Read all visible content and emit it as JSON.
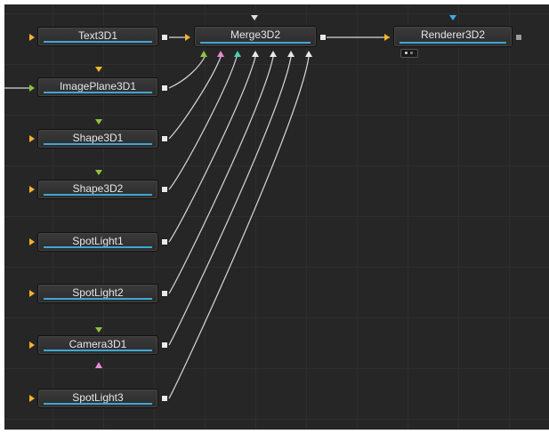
{
  "nodes": {
    "text3d1": "Text3D1",
    "merge3d2": "Merge3D2",
    "renderer3d2": "Renderer3D2",
    "imageplane3d1": "ImagePlane3D1",
    "shape3d1": "Shape3D1",
    "shape3d2": "Shape3D2",
    "spotlight1": "SpotLight1",
    "spotlight2": "SpotLight2",
    "camera3d1": "Camera3D1",
    "spotlight3": "SpotLight3"
  },
  "colors": {
    "background": "#262626",
    "node_bar": "#3ea6d6",
    "input_arrow": "#f5b32a",
    "effect_mask_green": "#8cc43c",
    "effect_mask_orange": "#f5b32a",
    "merge_input_green": "#8cc43c",
    "merge_input_pink": "#e98ad6",
    "merge_input_teal": "#48d1b0",
    "merge_input_white": "#e8e8e8",
    "renderer_top_input": "#3fa9f5"
  }
}
